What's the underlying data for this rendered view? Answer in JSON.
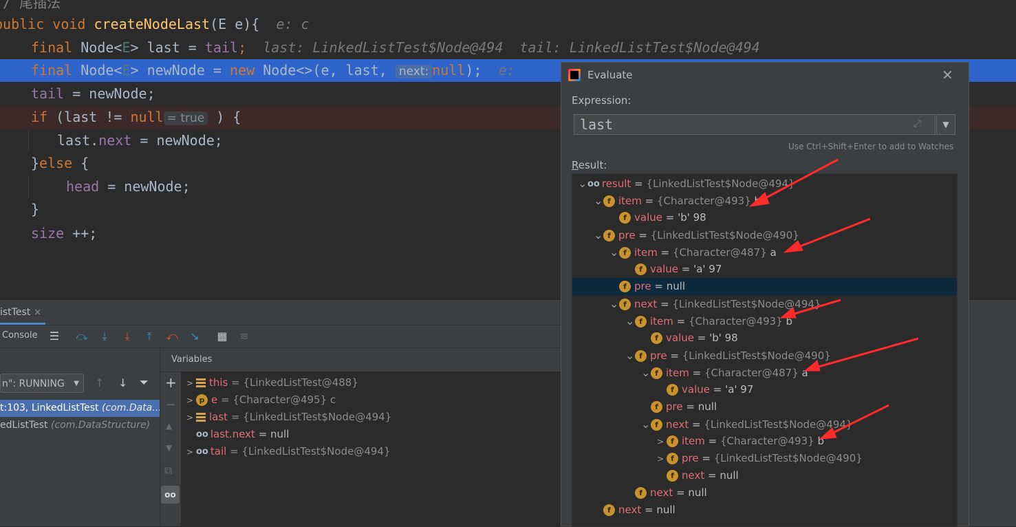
{
  "editor": {
    "lines": [
      {
        "id": "comment",
        "text": "/ 尾插法"
      },
      {
        "id": "sig_kw",
        "text": "public void "
      },
      {
        "id": "sig_fn",
        "text": "createNodeLast"
      },
      {
        "id": "sig_rest",
        "text": "(E e){"
      },
      {
        "id": "sig_hint",
        "text": "e: c"
      },
      {
        "id": "l2_a",
        "text": "final "
      },
      {
        "id": "l2_b",
        "text": "Node<"
      },
      {
        "id": "l2_c",
        "text": "E"
      },
      {
        "id": "l2_d",
        "text": "> last = "
      },
      {
        "id": "l2_e",
        "text": "tail"
      },
      {
        "id": "l2_f",
        "text": ";"
      },
      {
        "id": "l2_hint",
        "text": "last: LinkedListTest$Node@494  tail: LinkedListTest$Node@494"
      },
      {
        "id": "l3_a",
        "text": "final "
      },
      {
        "id": "l3_b",
        "text": "Node<"
      },
      {
        "id": "l3_c",
        "text": "E"
      },
      {
        "id": "l3_d",
        "text": "> newNode = "
      },
      {
        "id": "l3_e",
        "text": "new "
      },
      {
        "id": "l3_f",
        "text": "Node<>(e, last, "
      },
      {
        "id": "l3_inlay",
        "text": "next:"
      },
      {
        "id": "l3_g",
        "text": "null"
      },
      {
        "id": "l3_h",
        "text": ");"
      },
      {
        "id": "l3_hint",
        "text": "e:"
      },
      {
        "id": "l4_a",
        "text": "tail"
      },
      {
        "id": "l4_b",
        "text": " = newNode;"
      },
      {
        "id": "l5_a",
        "text": "if "
      },
      {
        "id": "l5_b",
        "text": "(last != "
      },
      {
        "id": "l5_c",
        "text": "null"
      },
      {
        "id": "l5_inlay",
        "text": "= true"
      },
      {
        "id": "l5_d",
        "text": " ) {"
      },
      {
        "id": "l6_a",
        "text": "last."
      },
      {
        "id": "l6_b",
        "text": "next"
      },
      {
        "id": "l6_c",
        "text": " = newNode;"
      },
      {
        "id": "l7_a",
        "text": "}"
      },
      {
        "id": "l7_b",
        "text": "else "
      },
      {
        "id": "l7_c",
        "text": "{"
      },
      {
        "id": "l8_a",
        "text": "head"
      },
      {
        "id": "l8_b",
        "text": " = newNode;"
      },
      {
        "id": "l9",
        "text": "}"
      },
      {
        "id": "l10_a",
        "text": "size"
      },
      {
        "id": "l10_b",
        "text": " ++;"
      }
    ]
  },
  "debug": {
    "tab_label": "istTest",
    "tab_close": "×",
    "console_label": "Console",
    "thread_select": "n\": RUNNING",
    "frames": [
      {
        "main": "t:103, LinkedListTest ",
        "pkg": "(com.Data..."
      },
      {
        "main": "edListTest ",
        "pkg": "(com.DataStructure)"
      }
    ],
    "variables_title": "Variables",
    "variables": [
      {
        "name": "this",
        "value": " = {LinkedListTest@488}",
        "icon": "lines",
        "expand": true
      },
      {
        "name": "e",
        "value": " = {Character@495} c",
        "icon": "p",
        "expand": true
      },
      {
        "name": "last",
        "value": " = {LinkedListTest$Node@494}",
        "icon": "lines",
        "expand": true
      },
      {
        "name": "last.next",
        "value": " = null",
        "icon": "watch",
        "expand": false
      },
      {
        "name": "tail",
        "value": " = {LinkedListTest$Node@494}",
        "icon": "watch",
        "expand": true
      }
    ]
  },
  "evaluate": {
    "title": "Evaluate",
    "close": "✕",
    "expression_label": "Expression:",
    "expression_value": "last",
    "hint": "Use Ctrl+Shift+Enter to add to Watches",
    "result_label_first": "R",
    "result_label_rest": "esult:",
    "tree": [
      {
        "depth": 0,
        "chev": "v",
        "icon": "watch",
        "name": "result",
        "eq": " = ",
        "val": "{LinkedListTest$Node@494}",
        "tail": ""
      },
      {
        "depth": 1,
        "chev": "v",
        "icon": "f",
        "name": "item",
        "eq": " = ",
        "val": "{Character@493}",
        "tail": " b"
      },
      {
        "depth": 2,
        "chev": "",
        "icon": "f",
        "name": "value",
        "eq": " = ",
        "val": "",
        "tail": "'b' 98"
      },
      {
        "depth": 1,
        "chev": "v",
        "icon": "f",
        "name": "pre",
        "eq": " = ",
        "val": "{LinkedListTest$Node@490}",
        "tail": ""
      },
      {
        "depth": 2,
        "chev": "v",
        "icon": "f",
        "name": "item",
        "eq": " = ",
        "val": "{Character@487}",
        "tail": " a"
      },
      {
        "depth": 3,
        "chev": "",
        "icon": "f",
        "name": "value",
        "eq": " = ",
        "val": "",
        "tail": "'a' 97"
      },
      {
        "depth": 2,
        "chev": "",
        "icon": "f",
        "name": "pre",
        "eq": " = ",
        "val": "",
        "tail": "null",
        "sel": true
      },
      {
        "depth": 2,
        "chev": "v",
        "icon": "f",
        "name": "next",
        "eq": " = ",
        "val": "{LinkedListTest$Node@494}",
        "tail": ""
      },
      {
        "depth": 3,
        "chev": "v",
        "icon": "f",
        "name": "item",
        "eq": " = ",
        "val": "{Character@493}",
        "tail": " b"
      },
      {
        "depth": 4,
        "chev": "",
        "icon": "f",
        "name": "value",
        "eq": " = ",
        "val": "",
        "tail": "'b' 98"
      },
      {
        "depth": 3,
        "chev": "v",
        "icon": "f",
        "name": "pre",
        "eq": " = ",
        "val": "{LinkedListTest$Node@490}",
        "tail": ""
      },
      {
        "depth": 4,
        "chev": "v",
        "icon": "f",
        "name": "item",
        "eq": " = ",
        "val": "{Character@487}",
        "tail": " a"
      },
      {
        "depth": 5,
        "chev": "",
        "icon": "f",
        "name": "value",
        "eq": " = ",
        "val": "",
        "tail": "'a' 97"
      },
      {
        "depth": 4,
        "chev": "",
        "icon": "f",
        "name": "pre",
        "eq": " = ",
        "val": "",
        "tail": "null"
      },
      {
        "depth": 4,
        "chev": "v",
        "icon": "f",
        "name": "next",
        "eq": " = ",
        "val": "{LinkedListTest$Node@494}",
        "tail": ""
      },
      {
        "depth": 5,
        "chev": ">",
        "icon": "f",
        "name": "item",
        "eq": " = ",
        "val": "{Character@493}",
        "tail": " b"
      },
      {
        "depth": 5,
        "chev": ">",
        "icon": "f",
        "name": "pre",
        "eq": " = ",
        "val": "{LinkedListTest$Node@490}",
        "tail": ""
      },
      {
        "depth": 5,
        "chev": "",
        "icon": "f",
        "name": "next",
        "eq": " = ",
        "val": "",
        "tail": "null"
      },
      {
        "depth": 3,
        "chev": "",
        "icon": "f",
        "name": "next",
        "eq": " = ",
        "val": "",
        "tail": "null"
      },
      {
        "depth": 1,
        "chev": "",
        "icon": "f",
        "name": "next",
        "eq": " = ",
        "val": "",
        "tail": "null"
      }
    ]
  },
  "colors": {
    "selection": "#2f65ca",
    "arrow": "#ff2b2b",
    "field_icon": "#c8932e"
  }
}
